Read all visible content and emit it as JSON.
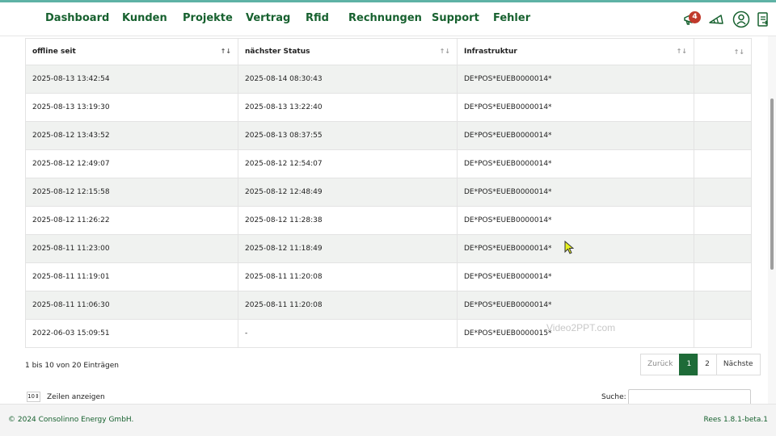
{
  "nav": {
    "items": [
      {
        "label": "Dashboard"
      },
      {
        "label": "Kunden"
      },
      {
        "label": "Projekte"
      },
      {
        "label": "Vertrag"
      },
      {
        "label": "Rfid"
      },
      {
        "label": "Rechnungen"
      },
      {
        "label": "Support"
      },
      {
        "label": "Fehler"
      }
    ],
    "notification_count": "4",
    "icons": [
      "megaphone-icon",
      "announcement-icon",
      "user-profile-icon",
      "logout-icon"
    ]
  },
  "table": {
    "columns": [
      "offline seit",
      "nächster Status",
      "Infrastruktur",
      ""
    ],
    "rows": [
      [
        "2025-08-13 13:42:54",
        "2025-08-14 08:30:43",
        "DE*POS*EUEB0000014*",
        ""
      ],
      [
        "2025-08-13 13:19:30",
        "2025-08-13 13:22:40",
        "DE*POS*EUEB0000014*",
        ""
      ],
      [
        "2025-08-12 13:43:52",
        "2025-08-13 08:37:55",
        "DE*POS*EUEB0000014*",
        ""
      ],
      [
        "2025-08-12 12:49:07",
        "2025-08-12 12:54:07",
        "DE*POS*EUEB0000014*",
        ""
      ],
      [
        "2025-08-12 12:15:58",
        "2025-08-12 12:48:49",
        "DE*POS*EUEB0000014*",
        ""
      ],
      [
        "2025-08-12 11:26:22",
        "2025-08-12 11:28:38",
        "DE*POS*EUEB0000014*",
        ""
      ],
      [
        "2025-08-11 11:23:00",
        "2025-08-12 11:18:49",
        "DE*POS*EUEB0000014*",
        ""
      ],
      [
        "2025-08-11 11:19:01",
        "2025-08-11 11:20:08",
        "DE*POS*EUEB0000014*",
        ""
      ],
      [
        "2025-08-11 11:06:30",
        "2025-08-11 11:20:08",
        "DE*POS*EUEB0000014*",
        ""
      ],
      [
        "2022-06-03 15:09:51",
        "-",
        "DE*POS*EUEB0000015*",
        ""
      ]
    ]
  },
  "pagination": {
    "info": "1 bis 10 von 20 Einträgen",
    "prev": "Zurück",
    "pages": [
      "1",
      "2"
    ],
    "next": "Nächste"
  },
  "controls": {
    "page_length": "10",
    "page_length_label": "Zeilen anzeigen",
    "search_label": "Suche:",
    "search_value": ""
  },
  "watermark": "Video2PPT.com",
  "footer": {
    "copyright": "© 2024 Consolinno Energy GmbH.",
    "version": "Rees 1.8.1-beta.1"
  },
  "colors": {
    "brand": "#17612f",
    "active_page": "#1e6b38",
    "badge": "#c0392b",
    "row_striped": "#f0f2f0"
  }
}
